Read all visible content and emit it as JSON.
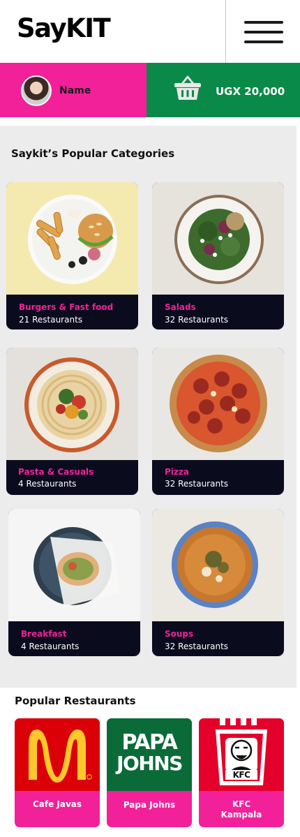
{
  "header": {
    "logo": "SayKIT"
  },
  "user": {
    "name": "Name"
  },
  "wallet": {
    "amount": "UGX 20,000"
  },
  "categories": {
    "title": "Saykit’s Popular Categories",
    "items": [
      {
        "name": "Burgers & Fast food",
        "count": "21 Restaurants"
      },
      {
        "name": "Salads",
        "count": "32 Restaurants"
      },
      {
        "name": "Pasta & Casuals",
        "count": "4 Restaurants"
      },
      {
        "name": "Pizza",
        "count": "32 Restaurants"
      },
      {
        "name": "Breakfast",
        "count": "4 Restaurants"
      },
      {
        "name": "Soups",
        "count": "32 Restaurants"
      }
    ]
  },
  "restaurants": {
    "title": "Popular Restaurants",
    "items": [
      {
        "name": "Cafe Javas",
        "logo_text": ""
      },
      {
        "name": "Papa Johns",
        "logo_text_1": "PAPA",
        "logo_text_2": "JOHNS"
      },
      {
        "name_line1": "KFC",
        "name_line2": "Kampala",
        "logo_text": "KFC"
      }
    ]
  },
  "colors": {
    "brand_pink": "#f2219a",
    "wallet_green": "#0a8a48",
    "card_dark": "#0b0b1e"
  }
}
